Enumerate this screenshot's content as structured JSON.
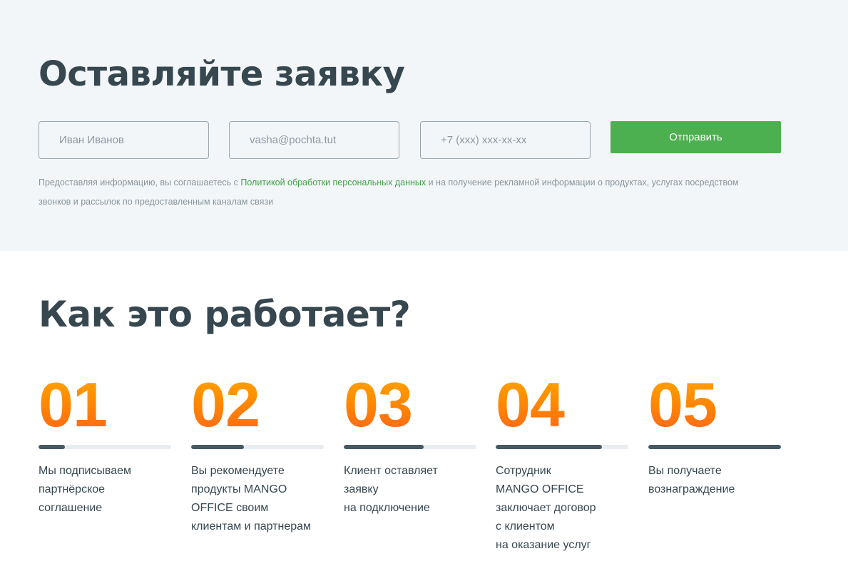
{
  "request_form": {
    "title": "Оставляйте заявку",
    "name_placeholder": "Иван Иванов",
    "email_placeholder": "vasha@pochta.tut",
    "phone_placeholder": "+7 (xxx) xxx-xx-xx",
    "submit_label": "Отправить",
    "consent_before": "Предоставляя информацию, вы соглашаетесь с ",
    "consent_link": "Политикой обработки персональных данных",
    "consent_after": " и на получение рекламной информации о продуктах, услугах посредством звонков и рассылок по предоставленным каналам связи"
  },
  "how_it_works": {
    "title": "Как это работает?",
    "steps": [
      {
        "number": "01",
        "progress": 0.2,
        "text": "Мы подписываем\nпартнёрское\nсоглашение"
      },
      {
        "number": "02",
        "progress": 0.4,
        "text": "Вы рекомендуете\nпродукты MANGO\nOFFICE своим\nклиентам и партнерам"
      },
      {
        "number": "03",
        "progress": 0.6,
        "text": "Клиент оставляет\nзаявку\nна подключение"
      },
      {
        "number": "04",
        "progress": 0.8,
        "text": "Сотрудник\nMANGO OFFICE\nзаключает договор\nс клиентом\nна оказание услуг"
      },
      {
        "number": "05",
        "progress": 1.0,
        "text": "Вы получаете\nвознаграждение"
      }
    ]
  },
  "colors": {
    "accent_green": "#4caf50",
    "link_green": "#43a047",
    "heading": "#37474f",
    "progress_fill": "#455a64",
    "progress_track": "#e8edf1",
    "number_gradient_top": "#ffab00",
    "number_gradient_bottom": "#ff5f1f"
  }
}
